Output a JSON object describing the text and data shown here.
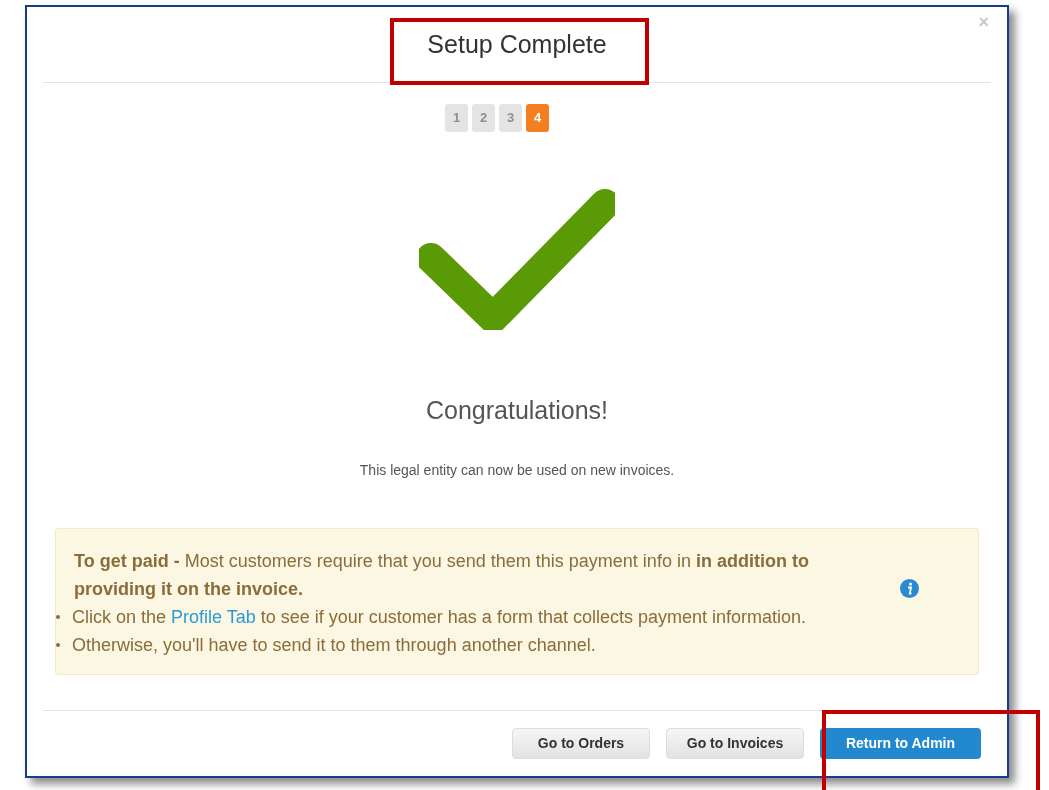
{
  "dialog": {
    "title": "Setup Complete",
    "close": "×",
    "steps": [
      {
        "label": "1",
        "selected": false
      },
      {
        "label": "2",
        "selected": false
      },
      {
        "label": "3",
        "selected": false
      },
      {
        "label": "4",
        "selected": true
      }
    ],
    "heading": "Congratulations!",
    "message": "This legal entity can now be used on new invoices.",
    "notice": {
      "intro": "**To get paid -** Most customers require that you send them this payment info in **in addition to providing it on the invoice.**",
      "bullets": [
        {
          "before": "Click on the ",
          "link": "Profile Tab",
          "after": " to see if your customer has a form that collects payment information."
        },
        {
          "before": "Otherwise, you'll have to send it to them through another channel."
        }
      ]
    },
    "buttons": [
      {
        "label": "Go to Orders",
        "kind": "default"
      },
      {
        "label": "Go to Invoices",
        "kind": "default"
      },
      {
        "label": "Return to Admin",
        "kind": "primary"
      }
    ]
  }
}
